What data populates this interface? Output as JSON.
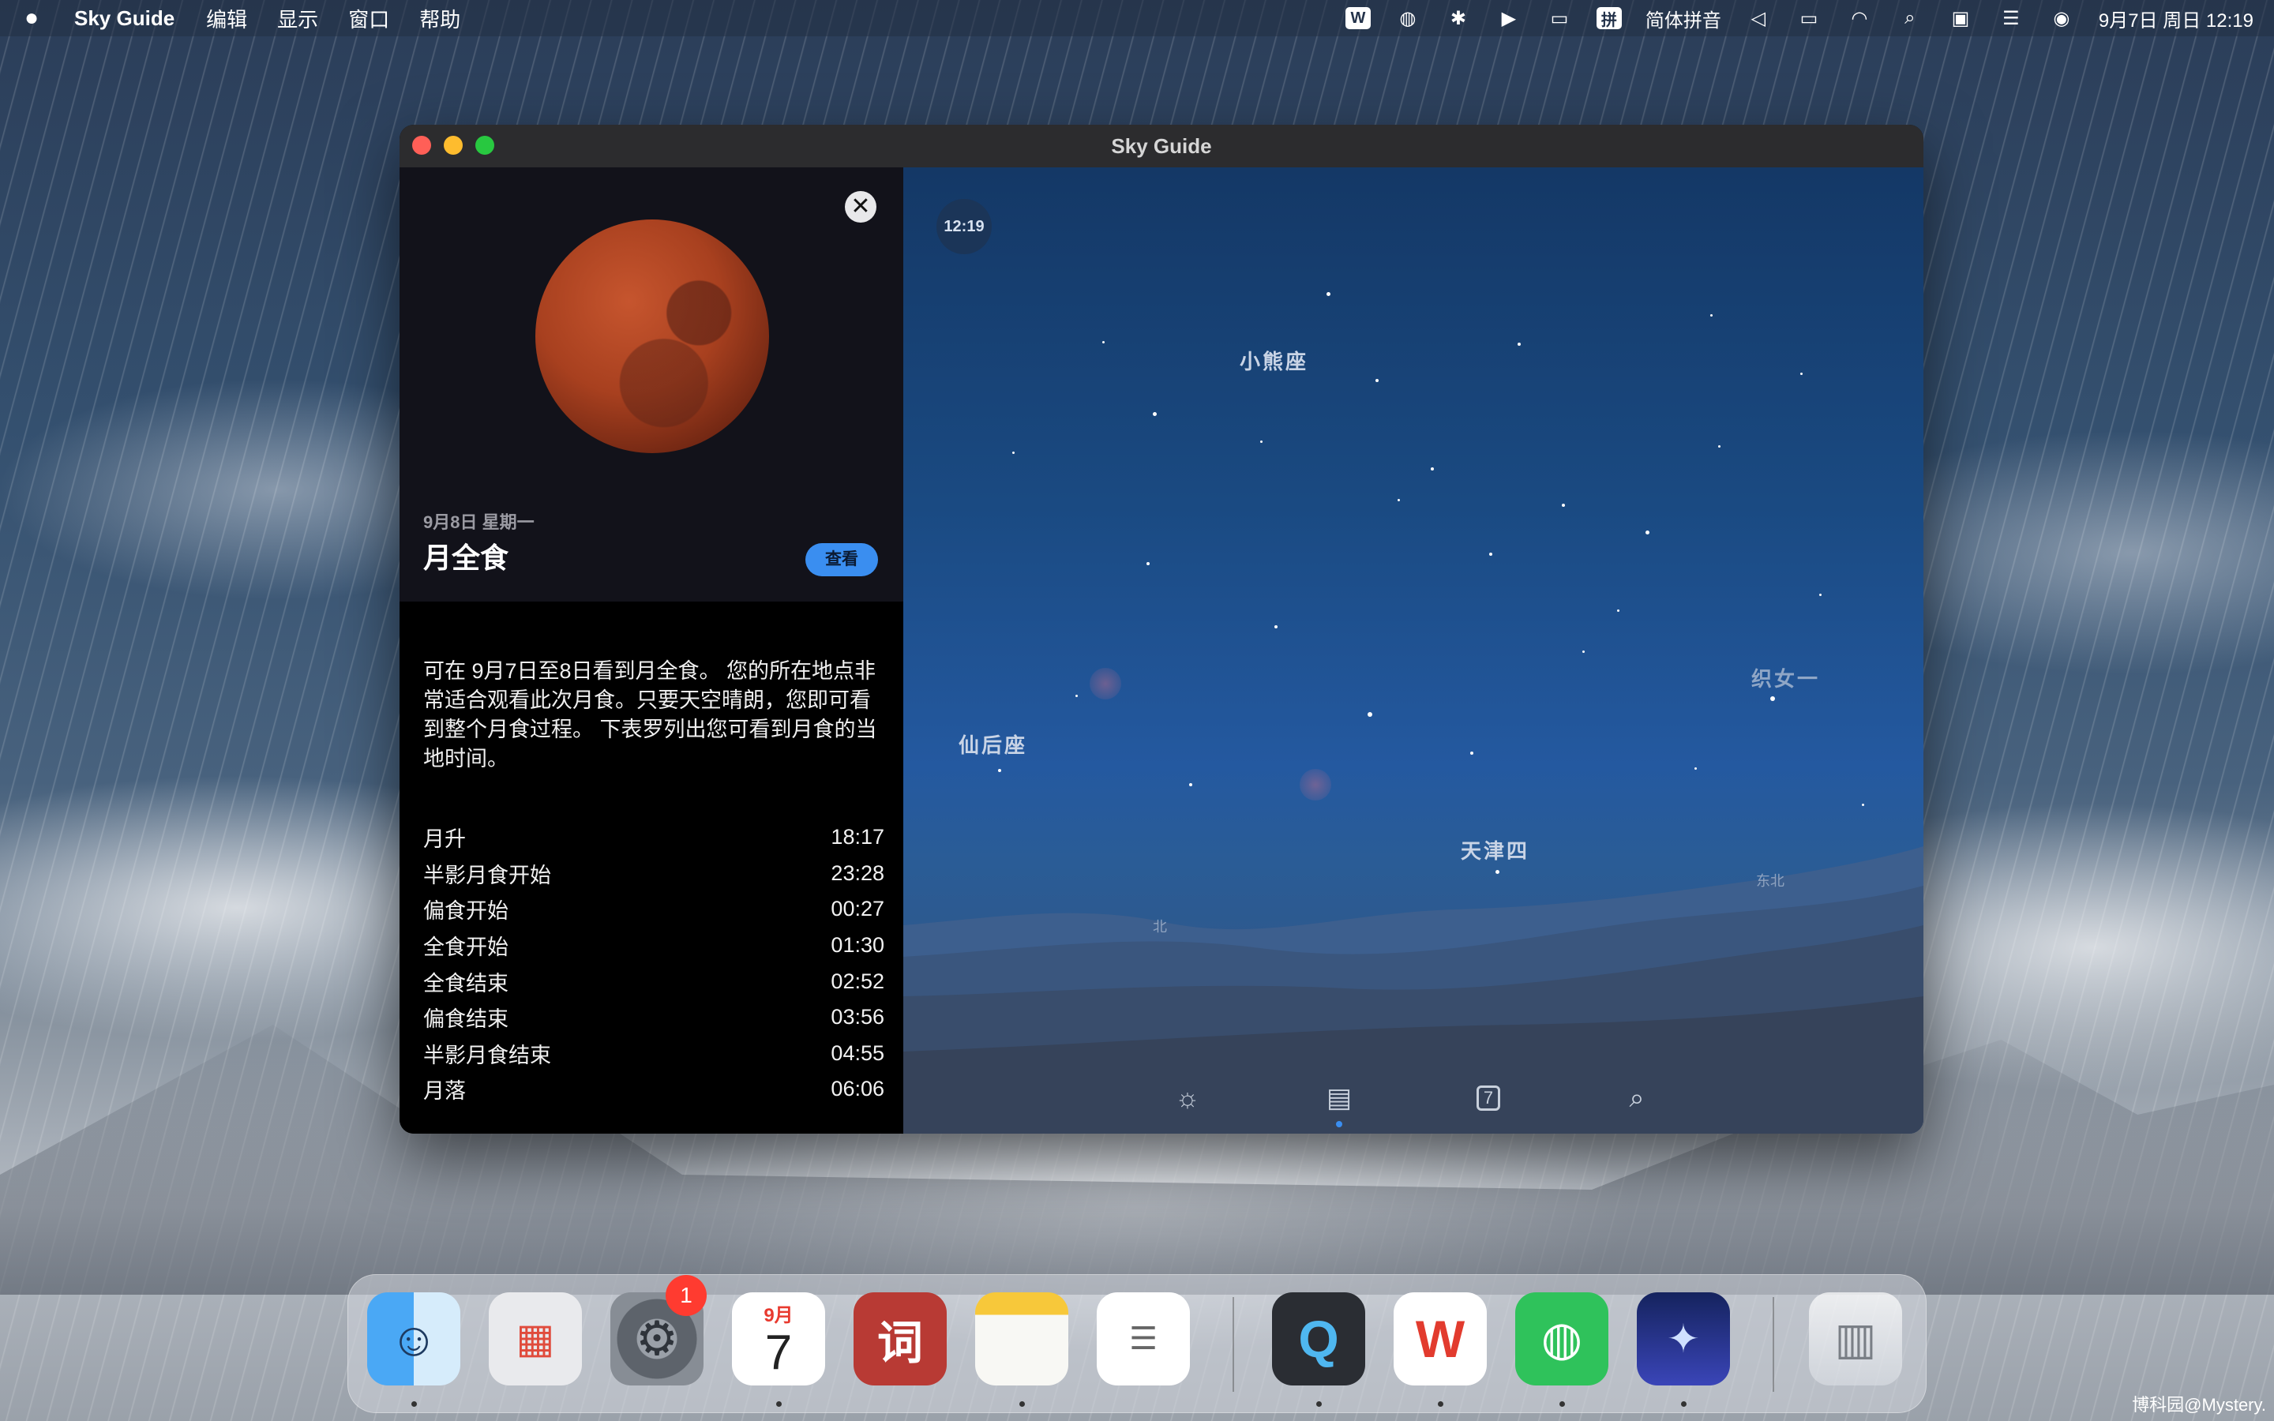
{
  "menubar": {
    "app_name": "Sky Guide",
    "menus": [
      "编辑",
      "显示",
      "窗口",
      "帮助"
    ],
    "status_icons": [
      "wps-icon",
      "wechat-icon",
      "bluetooth-icon",
      "play-icon",
      "battery-icon"
    ],
    "input_method_label": "拼",
    "input_method": "简体拼音",
    "right_icons": [
      "mute-icon",
      "display-icon",
      "wifi-icon",
      "search-icon",
      "photo-icon",
      "control-center-icon",
      "siri-icon"
    ],
    "datetime": "9月7日 周日 12:19"
  },
  "window": {
    "title": "Sky Guide"
  },
  "sidebar": {
    "close_label": "✕",
    "event_date": "9月8日 星期一",
    "event_title": "月全食",
    "view_button": "查看",
    "description": "可在 9月7日至8日看到月全食。 您的所在地点非常适合观看此次月食。只要天空晴朗，您即可看到整个月食过程。 下表罗列出您可看到月食的当地时间。",
    "times": [
      {
        "label": "月升",
        "time": "18:17"
      },
      {
        "label": "半影月食开始",
        "time": "23:28"
      },
      {
        "label": "偏食开始",
        "time": "00:27"
      },
      {
        "label": "全食开始",
        "time": "01:30"
      },
      {
        "label": "全食结束",
        "time": "02:52"
      },
      {
        "label": "偏食结束",
        "time": "03:56"
      },
      {
        "label": "半影月食结束",
        "time": "04:55"
      },
      {
        "label": "月落",
        "time": "06:06"
      }
    ]
  },
  "sky": {
    "time": "12:19",
    "constellations": {
      "ursa_minor": "小熊座",
      "cassiopeia": "仙后座",
      "vega": "织女一",
      "deneb": "天津四"
    },
    "directions": {
      "north": "北",
      "northeast": "东北"
    },
    "toolbar": [
      "sun-icon",
      "guide-icon",
      "calendar-icon",
      "search-icon"
    ],
    "calendar_day": "7"
  },
  "dock": {
    "apps": [
      "Finder",
      "Launchpad",
      "System Settings",
      "Calendar",
      "Dictionary",
      "Notes",
      "Reminders",
      "QuickTime Player",
      "WPS Office",
      "WeChat",
      "Sky Guide",
      "Trash"
    ],
    "settings_badge": "1",
    "calendar_month": "9月",
    "calendar_day": "7",
    "dictionary_glyph": "词"
  },
  "watermark": "博科园@Mystery."
}
